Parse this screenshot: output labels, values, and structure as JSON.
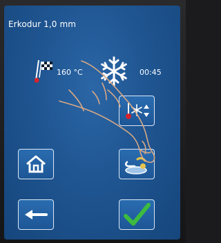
{
  "header": {
    "title": "Erkodur 1,0 mm"
  },
  "status": {
    "temperature": "160 °C",
    "cooling_time": "00:45"
  },
  "icons": {
    "heater": "heating-flag-icon",
    "cooling": "snowflake-icon",
    "home": "home-icon",
    "back": "back-arrow-icon",
    "confirm": "checkmark-icon",
    "adjust": "temperature-adjust-icon",
    "material": "material-cup-icon"
  },
  "colors": {
    "screen": "#1f5591",
    "accent_check": "#3dbb3f",
    "heater_red": "#d6242a"
  }
}
